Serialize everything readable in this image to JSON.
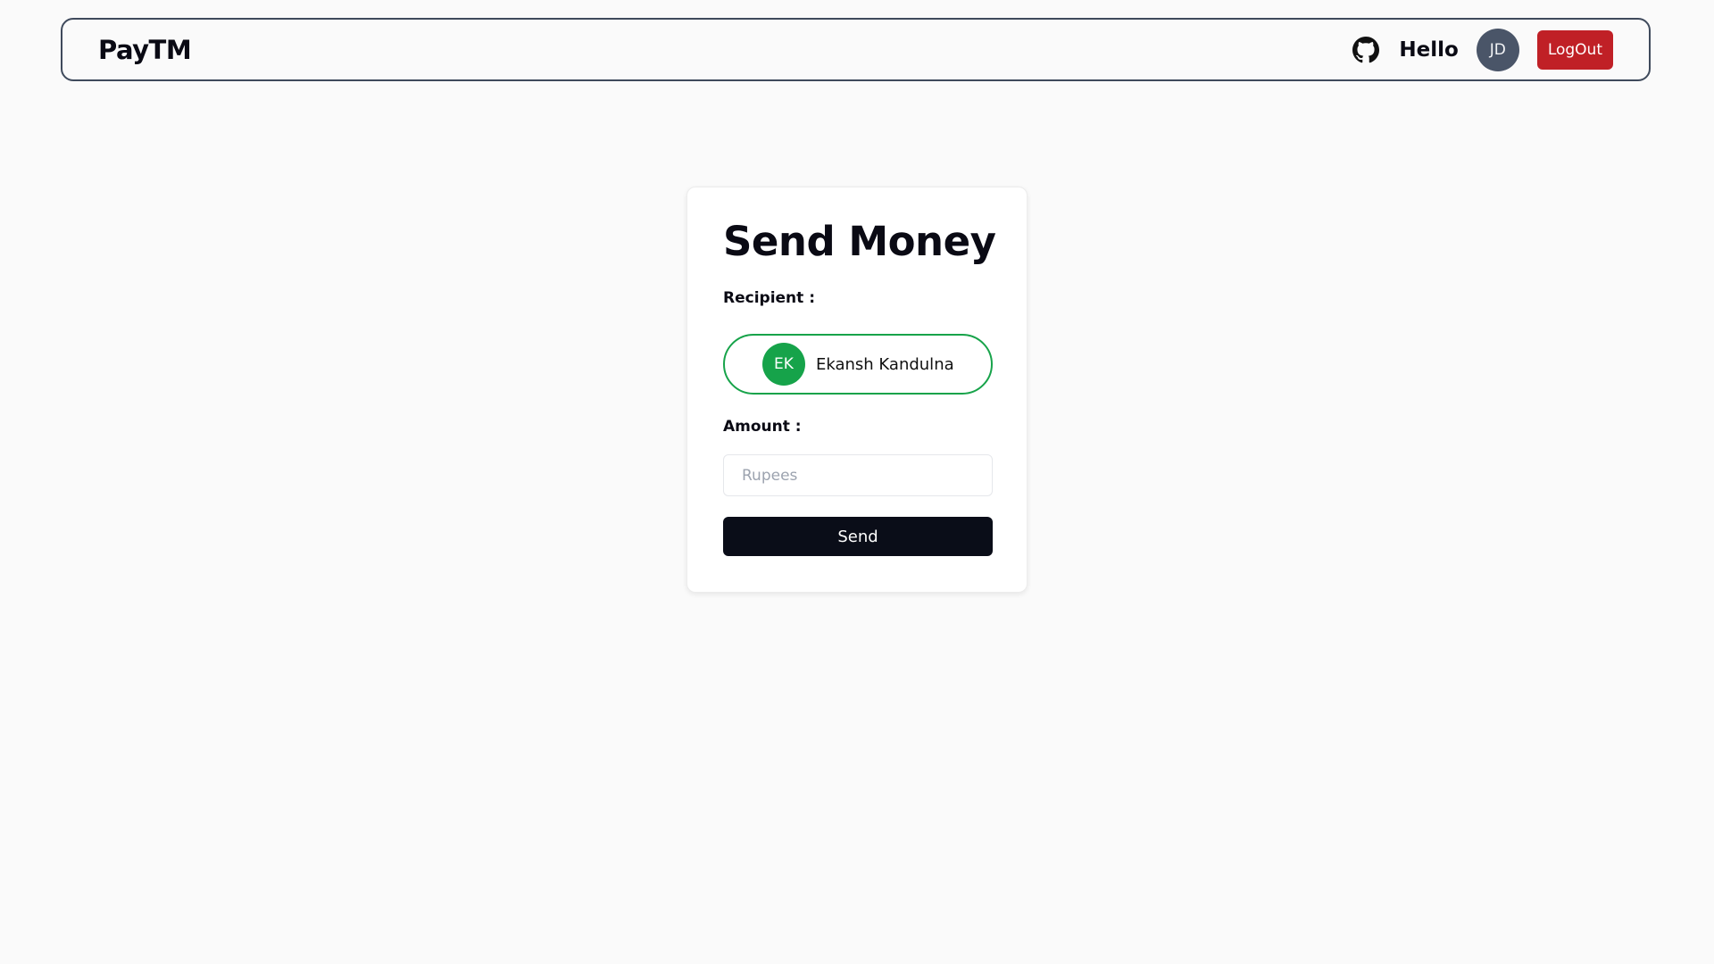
{
  "navbar": {
    "brand": "PayTM",
    "github_icon": "github-icon",
    "greeting": "Hello",
    "user_initials": "JD",
    "logout_label": "LogOut"
  },
  "card": {
    "title": "Send Money",
    "recipient_label": "Recipient :",
    "recipient": {
      "initials": "EK",
      "name": "Ekansh Kandulna"
    },
    "amount_label": "Amount :",
    "amount_placeholder": "Rupees",
    "amount_value": "",
    "send_label": "Send"
  },
  "colors": {
    "accent_green": "#16a34a",
    "logout_red": "#c02026",
    "send_button": "#0a0d18",
    "avatar_gray": "#4a5568"
  }
}
